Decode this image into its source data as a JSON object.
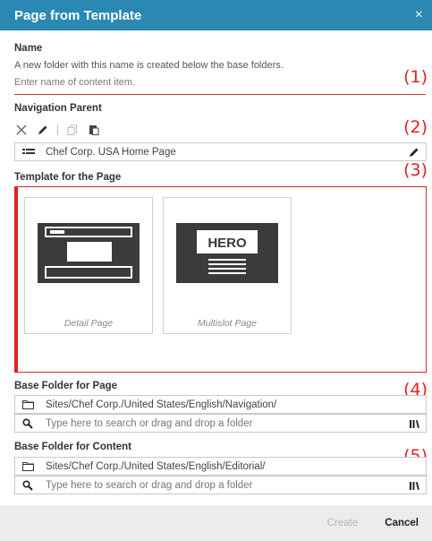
{
  "dialog": {
    "title": "Page from Template",
    "close_glyph": "×"
  },
  "annotations": [
    "(1)",
    "(2)",
    "(3)",
    "(4)",
    "(5)"
  ],
  "name_section": {
    "label": "Name",
    "description": "A new folder with this name is created below the base folders.",
    "placeholder": "Enter name of content item."
  },
  "navigation_parent": {
    "label": "Navigation Parent",
    "toolbar": [
      "remove-icon",
      "edit-icon",
      "copy-icon",
      "paste-icon"
    ],
    "value": "Chef Corp. USA Home Page",
    "value_icon": "page-list-icon",
    "action_icon": "pencil-icon"
  },
  "template_section": {
    "label": "Template for the Page",
    "templates": [
      {
        "caption": "Detail Page",
        "icon": "detail-page-thumbnail"
      },
      {
        "caption": "Multislot Page",
        "icon": "hero-thumbnail",
        "thumb_text": "HERO"
      }
    ]
  },
  "base_folder_page": {
    "label": "Base Folder for Page",
    "path": "Sites/Chef Corp./United States/English/Navigation/",
    "search_placeholder": "Type here to search or drag and drop a folder"
  },
  "base_folder_content": {
    "label": "Base Folder for Content",
    "path": "Sites/Chef Corp./United States/English/Editorial/",
    "search_placeholder": "Type here to search or drag and drop a folder"
  },
  "footer": {
    "create_label": "Create",
    "cancel_label": "Cancel"
  },
  "colors": {
    "titlebar": "#2a88b3",
    "annotation": "#e02222",
    "footer_bg": "#ececec"
  }
}
